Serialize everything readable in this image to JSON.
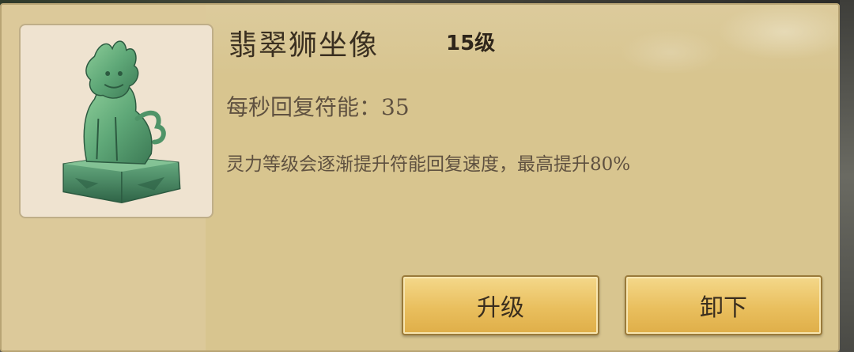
{
  "item": {
    "name": "翡翠狮坐像",
    "level": "15级",
    "image_icon": "jade-lion-statue-icon"
  },
  "stat": {
    "text": "每秒回复符能：35"
  },
  "description": {
    "text": "灵力等级会逐渐提升符能回复速度，最高提升80%"
  },
  "buttons": {
    "upgrade_label": "升级",
    "unequip_label": "卸下"
  },
  "colors": {
    "panel_bg": "#d8c58f",
    "button_gold": "#e9bf5e",
    "jade_green": "#5fa878"
  }
}
